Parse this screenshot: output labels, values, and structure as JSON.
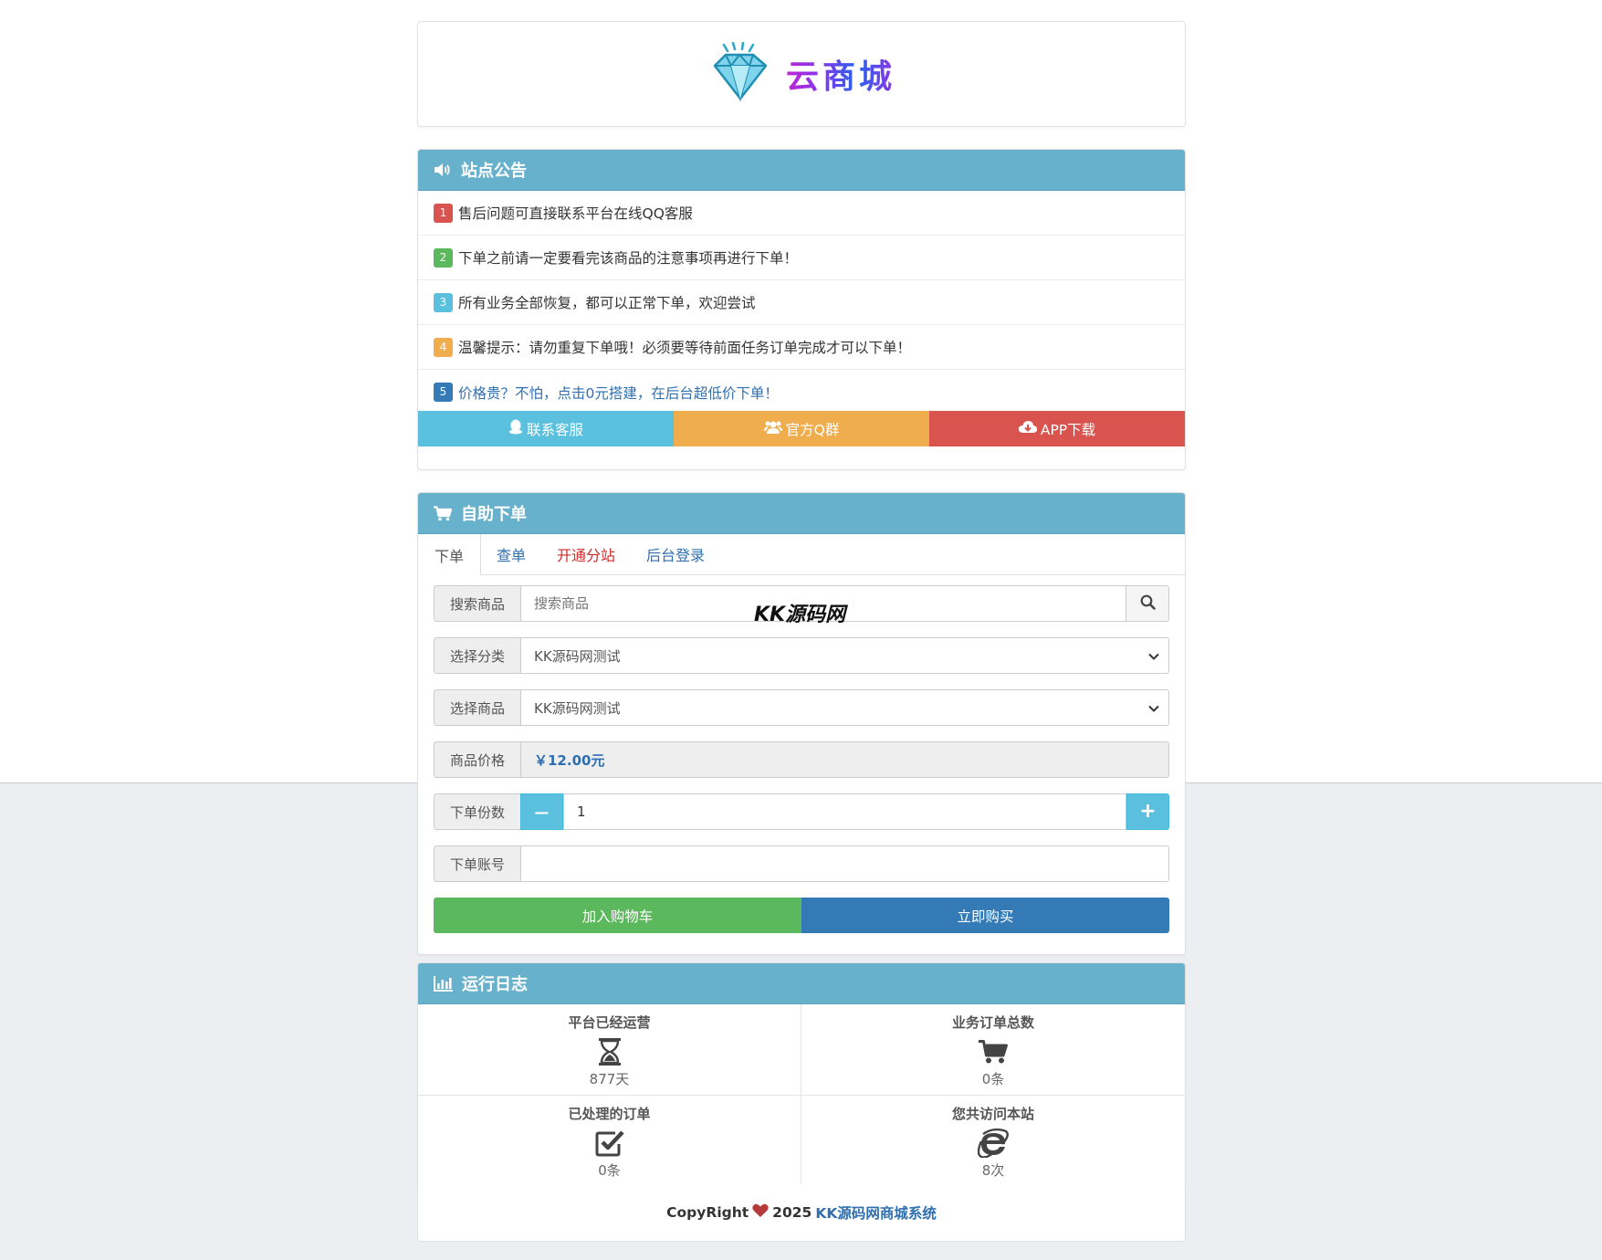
{
  "brand": {
    "name": "云商城",
    "colors": {
      "from": "#c026d3",
      "to": "#2563eb"
    }
  },
  "notice": {
    "title": "站点公告",
    "icon": "volume-icon",
    "items": [
      {
        "num": "1",
        "text": "售后问题可直接联系平台在线QQ客服",
        "color": "#d9534f"
      },
      {
        "num": "2",
        "text": "下单之前请一定要看完该商品的注意事项再进行下单！",
        "color": "#5cb85c"
      },
      {
        "num": "3",
        "text": "所有业务全部恢复，都可以正常下单，欢迎尝试",
        "color": "#5bc0de"
      },
      {
        "num": "4",
        "text": "温馨提示：请勿重复下单哦！必须要等待前面任务订单完成才可以下单！",
        "color": "#f0ad4e"
      },
      {
        "num": "5",
        "text": "价格贵？不怕，点击0元搭建，在后台超低价下单！",
        "color": "#337ab7"
      }
    ],
    "actions": [
      {
        "label": "联系客服",
        "icon": "qq-penguin-icon",
        "color": "#5bc0de"
      },
      {
        "label": "官方Q群",
        "icon": "users-icon",
        "color": "#f0ad4e"
      },
      {
        "label": "APP下载",
        "icon": "cloud-download-icon",
        "color": "#d9534f"
      }
    ]
  },
  "order": {
    "title": "自助下单",
    "icon": "cart-icon",
    "tabs": [
      "下单",
      "查单",
      "开通分站",
      "后台登录"
    ],
    "search": {
      "label": "搜索商品",
      "placeholder": "搜索商品"
    },
    "category": {
      "label": "选择分类",
      "value": "KK源码网测试"
    },
    "product": {
      "label": "选择商品",
      "value": "KK源码网测试"
    },
    "price": {
      "label": "商品价格",
      "value": "￥12.00元"
    },
    "quantity": {
      "label": "下单份数",
      "value": "1",
      "minus": "—",
      "plus": "+"
    },
    "account": {
      "label": "下单账号",
      "value": ""
    },
    "add_to_cart": "加入购物车",
    "buy_now": "立即购买"
  },
  "watermark": "KK源码网",
  "log": {
    "title": "运行日志",
    "icon": "bar-chart-icon",
    "stats": [
      {
        "label": "平台已经运营",
        "value": "877天",
        "icon": "hourglass-icon"
      },
      {
        "label": "业务订单总数",
        "value": "0条",
        "icon": "cart-icon"
      },
      {
        "label": "已处理的订单",
        "value": "0条",
        "icon": "check-square-icon"
      },
      {
        "label": "您共访问本站",
        "value": "8次",
        "icon": "ie-icon"
      }
    ]
  },
  "footer": {
    "prefix": "CopyRight",
    "year": "2025",
    "site": "KK源码网商城系统"
  }
}
